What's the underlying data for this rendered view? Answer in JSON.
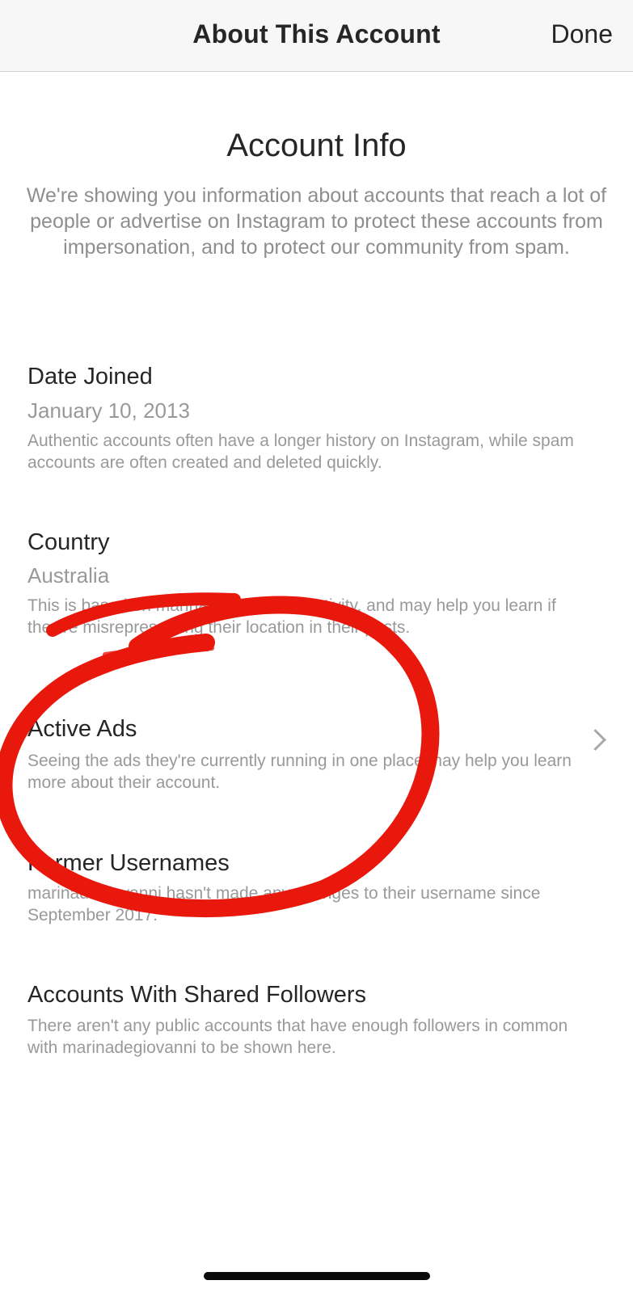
{
  "navbar": {
    "title": "About This Account",
    "done_label": "Done"
  },
  "header": {
    "title": "Account Info",
    "intro": "We're showing you information about accounts that reach a lot of people or advertise on Instagram to protect these accounts from impersonation, and to protect our community from spam."
  },
  "sections": {
    "date_joined": {
      "title": "Date Joined",
      "value": "January 10, 2013",
      "description": "Authentic accounts often have a longer history on Instagram, while spam accounts are often created and deleted quickly."
    },
    "country": {
      "title": "Country",
      "value": "Australia",
      "description": "This is based on marinadegiovanni's activity, and may help you learn if they're misrepresenting their location in their posts."
    },
    "active_ads": {
      "title": "Active Ads",
      "description": "Seeing the ads they're currently running in one place may help you learn more about their account."
    },
    "former_usernames": {
      "title": "Former Usernames",
      "description": "marinadegiovanni hasn't made any changes to their username since September 2017."
    },
    "shared_followers": {
      "title": "Accounts With Shared Followers",
      "description": "There aren't any public accounts that have enough followers in common with marinadegiovanni to be shown here."
    }
  },
  "colors": {
    "annotation": "#e8180c",
    "navbar_bg": "#f7f7f7",
    "secondary_text": "#999999"
  },
  "icons": {
    "active_ads_chevron": "chevron-right-icon"
  }
}
